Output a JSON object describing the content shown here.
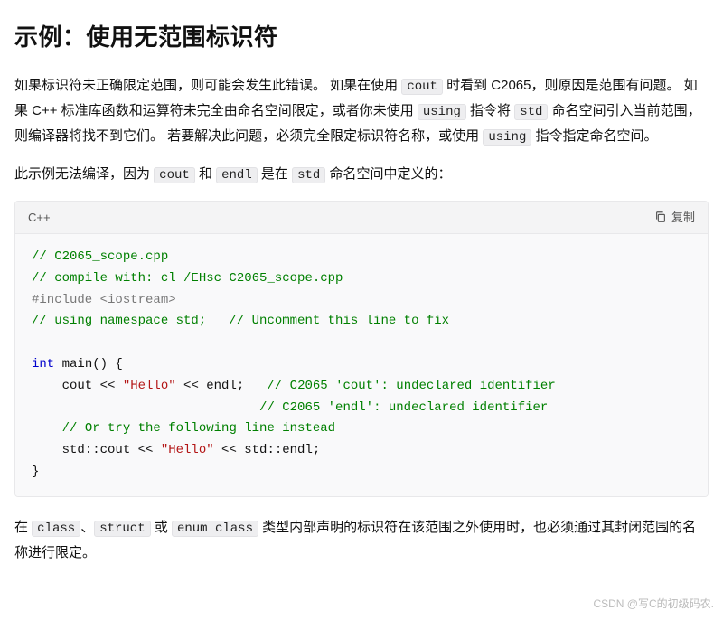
{
  "heading": "示例：使用无范围标识符",
  "para1": {
    "t1": "如果标识符未正确限定范围，则可能会发生此错误。 如果在使用 ",
    "c1": "cout",
    "t2": " 时看到 C2065，则原因是范围有问题。 如果 C++ 标准库函数和运算符未完全由命名空间限定，或者你未使用 ",
    "c2": "using",
    "t3": " 指令将 ",
    "c3": "std",
    "t4": " 命名空间引入当前范围，则编译器将找不到它们。 若要解决此问题，必须完全限定标识符名称，或使用 ",
    "c4": "using",
    "t5": " 指令指定命名空间。"
  },
  "para2": {
    "t1": "此示例无法编译，因为 ",
    "c1": "cout",
    "t2": " 和 ",
    "c2": "endl",
    "t3": " 是在 ",
    "c3": "std",
    "t4": " 命名空间中定义的："
  },
  "codeblock": {
    "lang": "C++",
    "copy_label": "复制",
    "lines": [
      {
        "c": "// C2065_scope.cpp"
      },
      {
        "c": "// compile with: cl /EHsc C2065_scope.cpp"
      },
      {
        "pp": "#include <iostream>"
      },
      {
        "c": "// using namespace std;   // Uncomment this line to fix"
      },
      {
        "pl": ""
      },
      {
        "kw": "int",
        "pl": " main() {"
      },
      {
        "pl": "    cout << ",
        "st": "\"Hello\"",
        "pl2": " << endl;   ",
        "c": "// C2065 'cout': undeclared identifier"
      },
      {
        "pl": "                              ",
        "c": "// C2065 'endl': undeclared identifier"
      },
      {
        "pl": "    ",
        "c": "// Or try the following line instead"
      },
      {
        "pl": "    std::cout << ",
        "st": "\"Hello\"",
        "pl2": " << std::endl;"
      },
      {
        "pl": "}"
      }
    ]
  },
  "para3": {
    "t1": "在 ",
    "c1": "class",
    "t2": "、",
    "c2": "struct",
    "t3": " 或 ",
    "c3": "enum class",
    "t4": " 类型内部声明的标识符在该范围之外使用时，也必须通过其封闭范围的名称进行限定。"
  },
  "watermark": "CSDN @写C的初级码农."
}
